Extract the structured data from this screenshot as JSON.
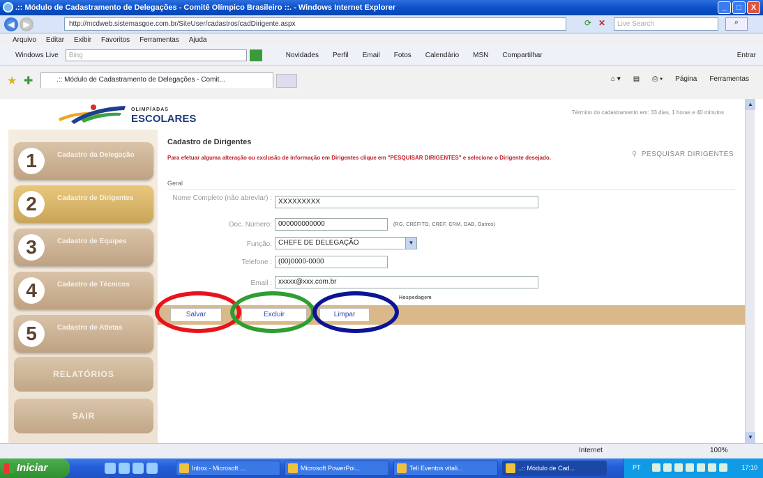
{
  "window": {
    "title": ".:: Módulo de Cadastramento de Delegações - Comitê Olímpico Brasileiro ::. - Windows Internet Explorer",
    "url": "http://mcdweb.sistemasgoe.com.br/SiteUser/cadastros/cadDirigente.aspx",
    "search_placeholder": "Live Search",
    "min_label": "_",
    "max_label": "□",
    "close_label": "X"
  },
  "menu": [
    "Arquivo",
    "Editar",
    "Exibir",
    "Favoritos",
    "Ferramentas",
    "Ajuda"
  ],
  "live_toolbar": {
    "label": "Windows Live",
    "search_placeholder": "Bing",
    "items": [
      "Novidades",
      "Perfil",
      "Email",
      "Fotos",
      "Calendário",
      "MSN",
      "Compartilhar"
    ],
    "entrar": "Entrar"
  },
  "tab": {
    "title": ".:: Módulo de Cadastramento de Delegações - Comit...",
    "commands": [
      "Página",
      "Ferramentas"
    ]
  },
  "header": {
    "logo_small": "OLIMPÍADAS",
    "logo_big": "ESCOLARES",
    "deadline": "Término do cadastramento em: 33 dias, 1 horas e 40 minutos"
  },
  "sidebar": {
    "steps": [
      {
        "num": "1",
        "label": "Cadastro da Delegação"
      },
      {
        "num": "2",
        "label": "Cadastro de Dirigentes"
      },
      {
        "num": "3",
        "label": "Cadastro de Equipes"
      },
      {
        "num": "4",
        "label": "Cadastro de Técnicos"
      },
      {
        "num": "5",
        "label": "Cadastro de Atletas"
      }
    ],
    "relatorios": "RELATÓRIOS",
    "sair": "SAIR"
  },
  "form": {
    "title": "Cadastro de Dirigentes",
    "note": "Para efetuar alguma alteração ou exclusão de informação em Dirigentes clique em \"PESQUISAR DIRIGENTES\" e selecione o Dirigente desejado.",
    "search_link": "PESQUISAR DIRIGENTES",
    "section": "Geral",
    "name_label": "Nome Completo (não abrevlar) :",
    "name_value": "XXXXXXXXX",
    "doc_label": "Doc. Número:",
    "doc_value": "000000000000",
    "doc_hint": "(RG, CREFITO, CREF, CRM, OAB, Outros)",
    "funcao_label": "Função:",
    "funcao_value": "CHEFE DE DELEGAÇÃO",
    "tel_label": "Telefone :",
    "tel_value": "(00)0000-0000",
    "email_label": "Email :",
    "email_value": "xxxxx@xxx.com.br",
    "hosp_label": "Hospedagem",
    "save": "Salvar",
    "delete": "Excluir",
    "clear": "Limpar"
  },
  "annotation_colors": {
    "save": "#e8141c",
    "delete": "#2e9e32",
    "clear": "#0c1496"
  },
  "status": {
    "zone": "Internet",
    "zoom": "100%"
  },
  "taskbar": {
    "start": "Iniciar",
    "tasks": [
      "Inbox - Microsoft ...",
      "Microsoft PowerPoi...",
      "Teli Eventos vitali...",
      "..:: Módulo de Cad..."
    ],
    "lang": "PT",
    "clock": "17:10"
  }
}
